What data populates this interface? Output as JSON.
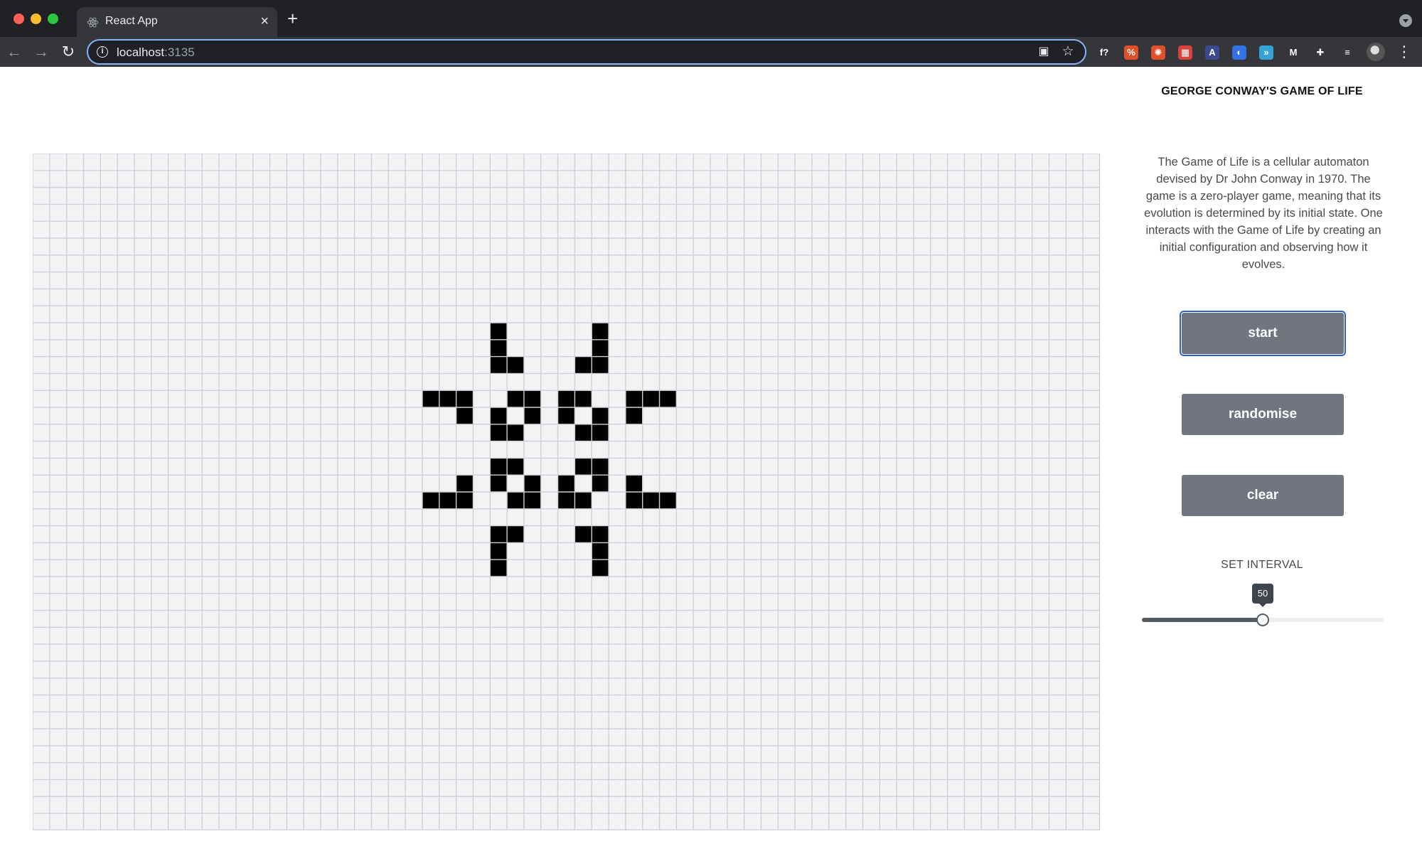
{
  "browser": {
    "tab_title": "React App",
    "close_glyph": "×",
    "new_tab_glyph": "+",
    "url_host": "localhost",
    "url_port": ":3135",
    "extensions": [
      {
        "name": "formula-extension-icon",
        "glyph": "f?",
        "color": "#35363a"
      },
      {
        "name": "percent-extension-icon",
        "glyph": "%",
        "color": "#e0502a"
      },
      {
        "name": "swirl-extension-icon",
        "glyph": "✺",
        "color": "#e0502a"
      },
      {
        "name": "calendar-extension-icon",
        "glyph": "▦",
        "color": "#d9423b"
      },
      {
        "name": "letter-a-extension-icon",
        "glyph": "A",
        "color": "#3b4a8f"
      },
      {
        "name": "blue-circle-extension-icon",
        "glyph": "◐",
        "color": "#3372e6"
      },
      {
        "name": "chevron-extension-icon",
        "glyph": "»",
        "color": "#34a3d6"
      },
      {
        "name": "medium-extension-icon",
        "glyph": "M",
        "color": "#35363a"
      },
      {
        "name": "puzzle-extension-icon",
        "glyph": "✚",
        "color": "#35363a"
      },
      {
        "name": "reading-list-icon",
        "glyph": "≡",
        "color": "#35363a"
      }
    ]
  },
  "game": {
    "title": "GEORGE CONWAY'S GAME OF LIFE",
    "description": "The Game of Life is a cellular automaton devised by Dr John Conway in 1970. The game is a zero-player game, meaning that its evolution is determined by its initial state. One interacts with the Game of Life by creating an initial configuration and observing how it evolves.",
    "buttons": {
      "start": "start",
      "randomise": "randomise",
      "clear": "clear"
    },
    "interval": {
      "label": "SET INTERVAL",
      "value": 50,
      "min": 0,
      "max": 100
    }
  },
  "grid": {
    "cols": 63,
    "rows": 40,
    "live_color": "#000000",
    "dead_color": "#f3f3f6",
    "line_color": "#cfd0d6",
    "live_cells": [
      [
        27,
        10
      ],
      [
        33,
        10
      ],
      [
        27,
        11
      ],
      [
        33,
        11
      ],
      [
        27,
        12
      ],
      [
        28,
        12
      ],
      [
        32,
        12
      ],
      [
        33,
        12
      ],
      [
        23,
        14
      ],
      [
        24,
        14
      ],
      [
        25,
        14
      ],
      [
        28,
        14
      ],
      [
        29,
        14
      ],
      [
        31,
        14
      ],
      [
        32,
        14
      ],
      [
        35,
        14
      ],
      [
        36,
        14
      ],
      [
        37,
        14
      ],
      [
        25,
        15
      ],
      [
        27,
        15
      ],
      [
        29,
        15
      ],
      [
        31,
        15
      ],
      [
        33,
        15
      ],
      [
        35,
        15
      ],
      [
        27,
        16
      ],
      [
        28,
        16
      ],
      [
        32,
        16
      ],
      [
        33,
        16
      ],
      [
        27,
        18
      ],
      [
        28,
        18
      ],
      [
        32,
        18
      ],
      [
        33,
        18
      ],
      [
        25,
        19
      ],
      [
        27,
        19
      ],
      [
        29,
        19
      ],
      [
        31,
        19
      ],
      [
        33,
        19
      ],
      [
        35,
        19
      ],
      [
        23,
        20
      ],
      [
        24,
        20
      ],
      [
        25,
        20
      ],
      [
        28,
        20
      ],
      [
        29,
        20
      ],
      [
        31,
        20
      ],
      [
        32,
        20
      ],
      [
        35,
        20
      ],
      [
        36,
        20
      ],
      [
        37,
        20
      ],
      [
        27,
        22
      ],
      [
        28,
        22
      ],
      [
        32,
        22
      ],
      [
        33,
        22
      ],
      [
        27,
        23
      ],
      [
        33,
        23
      ],
      [
        27,
        24
      ],
      [
        33,
        24
      ]
    ]
  }
}
